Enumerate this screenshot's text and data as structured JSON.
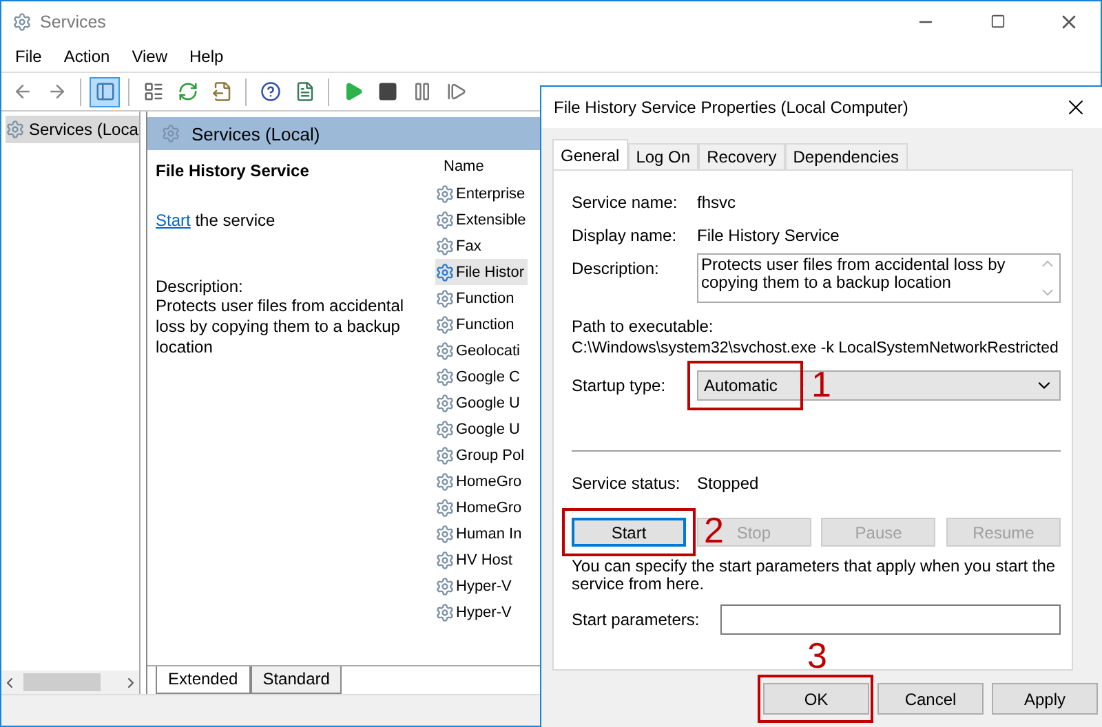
{
  "window": {
    "title": "Services"
  },
  "menu": [
    "File",
    "Action",
    "View",
    "Help"
  ],
  "toolbar": [
    {
      "kind": "back",
      "selected": false
    },
    {
      "kind": "forward",
      "selected": false
    },
    {
      "kind": "sep"
    },
    {
      "kind": "tree",
      "selected": true
    },
    {
      "kind": "sep"
    },
    {
      "kind": "properties",
      "selected": false
    },
    {
      "kind": "refresh",
      "selected": false
    },
    {
      "kind": "export",
      "selected": false
    },
    {
      "kind": "sep"
    },
    {
      "kind": "help",
      "selected": false
    },
    {
      "kind": "console",
      "selected": false
    },
    {
      "kind": "sep"
    },
    {
      "kind": "play",
      "selected": false
    },
    {
      "kind": "stop",
      "selected": false
    },
    {
      "kind": "pause",
      "selected": false
    },
    {
      "kind": "resume",
      "selected": false
    }
  ],
  "tree": {
    "items": [
      {
        "label": "Services (Loca",
        "selected": true
      }
    ]
  },
  "pane": {
    "header": "Services (Local)",
    "service_title": "File History Service",
    "action_link": "Start",
    "action_text": "the service",
    "description_label": "Description:",
    "description": "Protects user files from accidental loss by copying them to a backup location"
  },
  "list": {
    "column": "Name",
    "rows": [
      {
        "name": "Enterprise",
        "selected": false
      },
      {
        "name": "Extensible",
        "selected": false
      },
      {
        "name": "Fax",
        "selected": false
      },
      {
        "name": "File Histor",
        "selected": true
      },
      {
        "name": "Function",
        "selected": false
      },
      {
        "name": "Function",
        "selected": false
      },
      {
        "name": "Geolocati",
        "selected": false
      },
      {
        "name": "Google C",
        "selected": false
      },
      {
        "name": "Google U",
        "selected": false
      },
      {
        "name": "Google U",
        "selected": false
      },
      {
        "name": "Group Pol",
        "selected": false
      },
      {
        "name": "HomeGro",
        "selected": false
      },
      {
        "name": "HomeGro",
        "selected": false
      },
      {
        "name": "Human In",
        "selected": false
      },
      {
        "name": "HV Host",
        "selected": false
      },
      {
        "name": "Hyper-V",
        "selected": false
      },
      {
        "name": "Hyper-V",
        "selected": false
      }
    ]
  },
  "view_tabs": [
    {
      "label": "Extended",
      "selected": true
    },
    {
      "label": "Standard",
      "selected": false
    }
  ],
  "dialog": {
    "title": "File History Service Properties (Local Computer)",
    "tabs": [
      {
        "label": "General",
        "selected": true
      },
      {
        "label": "Log On",
        "selected": false
      },
      {
        "label": "Recovery",
        "selected": false
      },
      {
        "label": "Dependencies",
        "selected": false
      }
    ],
    "fields": [
      {
        "label": "Service name:",
        "value": "fhsvc"
      },
      {
        "label": "Display name:",
        "value": "File History Service"
      }
    ],
    "description": {
      "label": "Description:",
      "value": "Protects user files from accidental loss by copying them to a backup location"
    },
    "path": {
      "label": "Path to executable:",
      "value": "C:\\Windows\\system32\\svchost.exe -k LocalSystemNetworkRestricted"
    },
    "startup_type": {
      "label": "Startup type:",
      "value": "Automatic",
      "callout": "1"
    },
    "status": {
      "label": "Service status:",
      "value": "Stopped"
    },
    "service_buttons": [
      {
        "label": "Start",
        "disabled": false,
        "callout": "2"
      },
      {
        "label": "Stop",
        "disabled": true
      },
      {
        "label": "Pause",
        "disabled": true
      },
      {
        "label": "Resume",
        "disabled": true
      }
    ],
    "hint": "You can specify the start parameters that apply when you start the service from here.",
    "start_parameters": {
      "label": "Start parameters:"
    },
    "buttons": [
      {
        "label": "OK",
        "callout": "3"
      },
      {
        "label": "Cancel"
      },
      {
        "label": "Apply"
      }
    ]
  }
}
